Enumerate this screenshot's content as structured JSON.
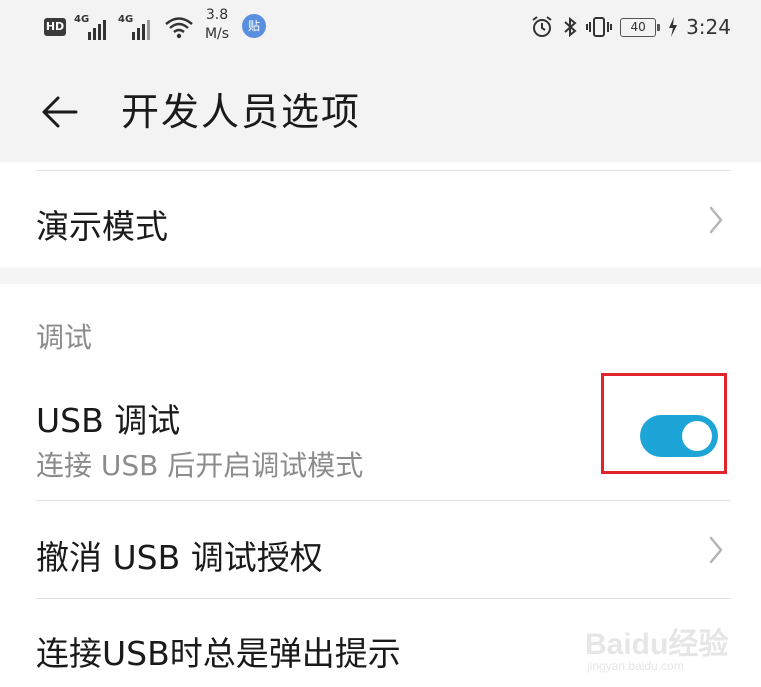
{
  "status_bar": {
    "hd": "HD",
    "net1": "4G",
    "net2": "4G",
    "speed_value": "3.8",
    "speed_unit": "M/s",
    "notification_badge": "贴",
    "battery": "40",
    "time": "3:24",
    "icons": [
      "hd-icon",
      "signal-icon",
      "signal-icon",
      "wifi-icon",
      "alarm-icon",
      "bluetooth-icon",
      "vibrate-icon",
      "battery-icon",
      "charging-icon"
    ]
  },
  "header": {
    "title": "开发人员选项",
    "back_icon": "arrow-left-icon"
  },
  "rows": {
    "demo_mode": "演示模式",
    "section_debug": "调试",
    "usb_debug_title": "USB 调试",
    "usb_debug_sub": "连接 USB 后开启调试模式",
    "usb_debug_enabled": true,
    "revoke_usb": "撤消 USB 调试授权",
    "always_prompt": "连接USB时总是弹出提示"
  },
  "watermark": {
    "brand": "Baidu经验",
    "url": "jingyan.baidu.com"
  },
  "colors": {
    "toggle_on": "#1ea5d8",
    "highlight_box": "#e0242c",
    "background": "#f5f5f5"
  }
}
